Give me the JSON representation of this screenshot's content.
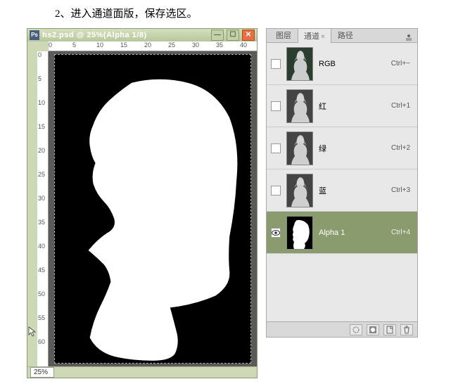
{
  "instruction": "2、进入通道面版，保存选区。",
  "window": {
    "title": "hs2.psd @ 25%(Alpha 1/8)",
    "zoom": "25%"
  },
  "ruler_h": [
    0,
    5,
    10,
    15,
    20,
    25,
    30,
    35,
    40
  ],
  "ruler_v": [
    0,
    5,
    10,
    15,
    20,
    25,
    30,
    35,
    40,
    45,
    50,
    55,
    60
  ],
  "panel": {
    "tabs": {
      "layers": "图层",
      "channels": "通道",
      "paths": "路径"
    },
    "channels": [
      {
        "name": "RGB",
        "shortcut": "Ctrl+~",
        "visible": false,
        "selected": false,
        "thumb_bg": "#2a3d2f",
        "alpha": false
      },
      {
        "name": "红",
        "shortcut": "Ctrl+1",
        "visible": false,
        "selected": false,
        "thumb_bg": "#444",
        "alpha": false
      },
      {
        "name": "绿",
        "shortcut": "Ctrl+2",
        "visible": false,
        "selected": false,
        "thumb_bg": "#444",
        "alpha": false
      },
      {
        "name": "蓝",
        "shortcut": "Ctrl+3",
        "visible": false,
        "selected": false,
        "thumb_bg": "#444",
        "alpha": false
      },
      {
        "name": "Alpha 1",
        "shortcut": "Ctrl+4",
        "visible": true,
        "selected": true,
        "thumb_bg": "#000",
        "alpha": true
      }
    ]
  }
}
